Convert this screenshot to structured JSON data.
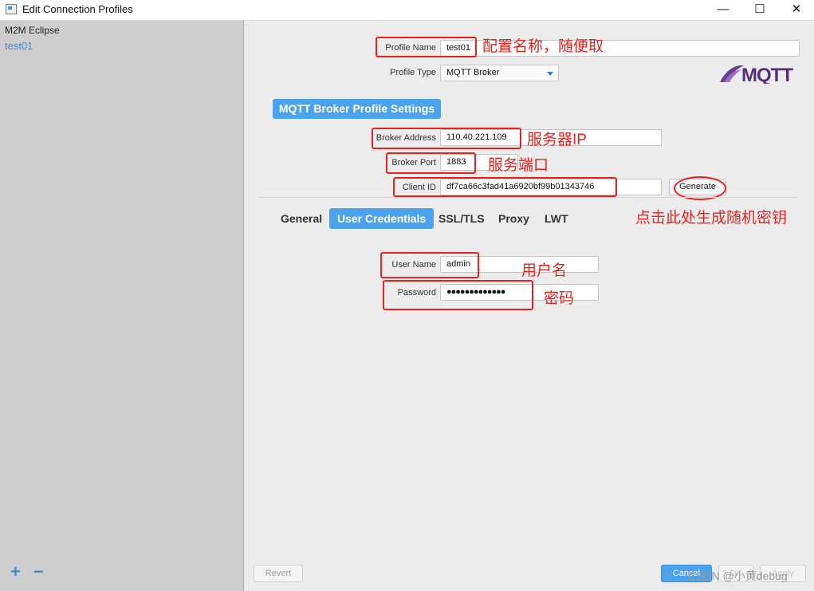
{
  "window": {
    "title": "Edit Connection Profiles",
    "minimize_glyph": "—",
    "maximize_glyph": "☐",
    "close_glyph": "✕"
  },
  "sidebar": {
    "group_label": "M2M Eclipse",
    "profiles": [
      "test01"
    ],
    "add_glyph": "+",
    "remove_glyph": "−"
  },
  "profile": {
    "name_label": "Profile Name",
    "name_value": "test01",
    "type_label": "Profile Type",
    "type_value": "MQTT Broker"
  },
  "logo_text": "MQTT",
  "broker_section": {
    "title": "MQTT Broker Profile Settings",
    "address_label": "Broker Address",
    "address_value": "110.40.221.109",
    "port_label": "Broker Port",
    "port_value": "1883",
    "client_id_label": "Client ID",
    "client_id_value": "df7ca66c3fad41a6920bf99b01343746",
    "generate_label": "Generate"
  },
  "tabs": [
    "General",
    "User Credentials",
    "SSL/TLS",
    "Proxy",
    "LWT"
  ],
  "active_tab": "User Credentials",
  "credentials": {
    "username_label": "User Name",
    "username_value": "admin",
    "password_label": "Password",
    "password_value": "●●●●●●●●●●●●●"
  },
  "annotations": {
    "profile_name": "配置名称，随便取",
    "server_ip": "服务器IP",
    "server_port": "服务端口",
    "generate": "点击此处生成随机密钥",
    "username": "用户名",
    "password": "密码"
  },
  "footer": {
    "revert_label": "Revert",
    "cancel_label": "Cancel",
    "ok_label": "OK",
    "apply_label": "Apply"
  },
  "watermark": "CSDN @小黄debug",
  "colors": {
    "accent": "#4aa3ec",
    "annotation": "#e8231f"
  }
}
